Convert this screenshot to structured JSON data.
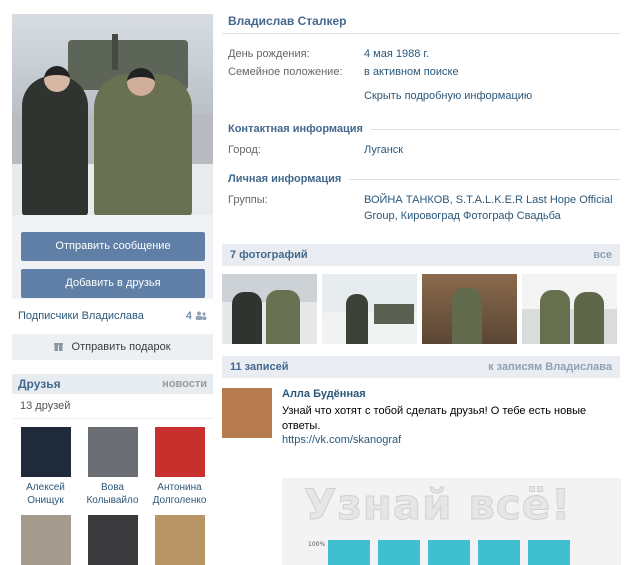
{
  "profile": {
    "name": "Владислав Сталкер",
    "birthday_label": "День рождения:",
    "birthday_value": "4 мая 1988 г.",
    "family_label": "Семейное положение:",
    "family_value": "в активном поиске",
    "hide_link": "Скрыть подробную информацию"
  },
  "contact": {
    "title": "Контактная информация",
    "city_label": "Город:",
    "city_value": "Луганск"
  },
  "personal": {
    "title": "Личная информация",
    "groups_label": "Группы:",
    "groups_value": "ВОЙНА ТАНКОВ, S.T.A.L.K.E.R Last Hope Official Group, Кировоград Фотограф Свадьба"
  },
  "actions": {
    "message_button": "Отправить сообщение",
    "add_friend_button": "Добавить в друзья",
    "subscribers_label": "Подписчики Владислава",
    "subscribers_count": "4",
    "gift_button": "Отправить подарок"
  },
  "friends": {
    "title": "Друзья",
    "news_link": "новости",
    "count": "13 друзей",
    "items": [
      {
        "first": "Алексей",
        "last": "Онищук",
        "color": "#1f2b3a"
      },
      {
        "first": "Вова",
        "last": "Колывайло",
        "color": "#6b6e73"
      },
      {
        "first": "Антонина",
        "last": "Долголенко",
        "color": "#c8302d"
      }
    ]
  },
  "photos": {
    "title": "7 фотографий",
    "all_link": "все"
  },
  "wall": {
    "title": "11 записей",
    "link": "к записям Владислава",
    "post": {
      "author": "Алла Будённая",
      "text": "Узнай что хотят с тобой сделать друзья! О тебе есть новые ответы.",
      "url": "https://vk.com/skanograf",
      "image_title": "Узнай всё!",
      "image_pct": "100%"
    }
  },
  "icons": {
    "subscribers": "people-icon",
    "gift": "gift-icon"
  }
}
